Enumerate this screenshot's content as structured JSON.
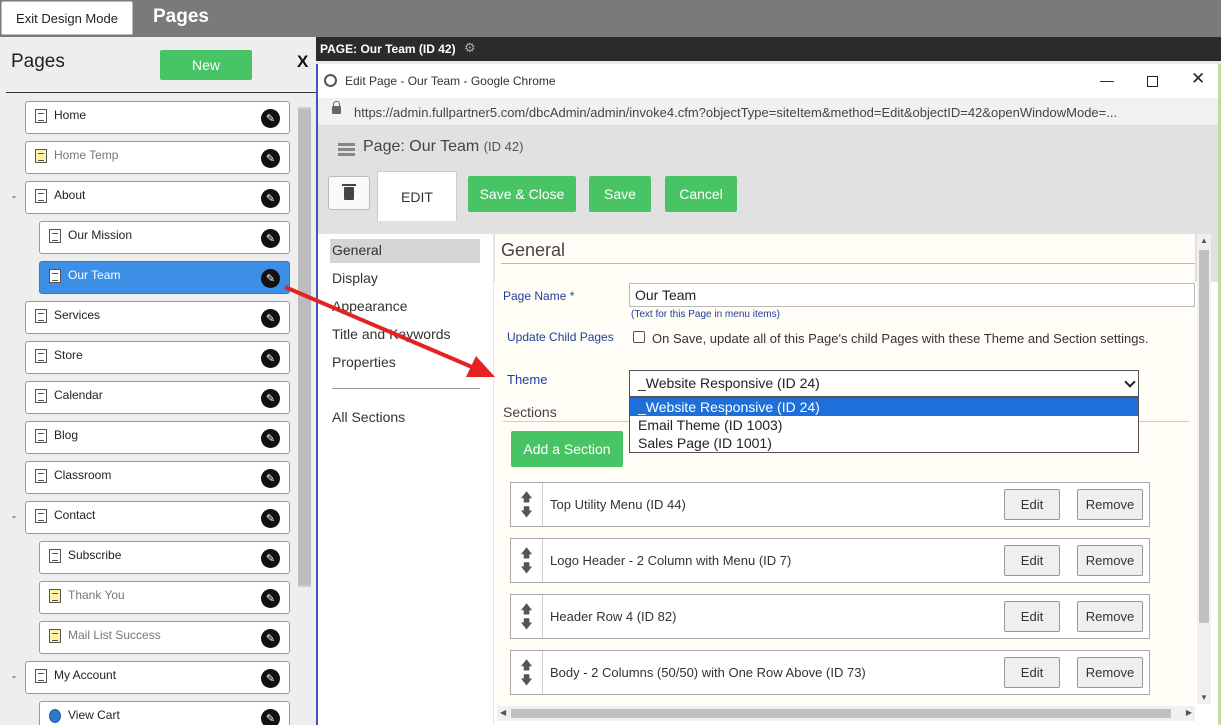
{
  "topbar": {
    "exit_label": "Exit Design Mode",
    "title": "Pages"
  },
  "left_panel": {
    "title": "Pages",
    "new_label": "New",
    "close_label": "X",
    "items": [
      {
        "label": "Home",
        "icon": "page-icon",
        "muted": false,
        "selected": false,
        "indent": false,
        "dash": false
      },
      {
        "label": "Home Temp",
        "icon": "page-hidden-icon",
        "muted": true,
        "selected": false,
        "indent": false,
        "dash": false
      },
      {
        "label": "About",
        "icon": "page-icon",
        "muted": false,
        "selected": false,
        "indent": false,
        "dash": true
      },
      {
        "label": "Our Mission",
        "icon": "page-icon",
        "muted": false,
        "selected": false,
        "indent": true,
        "dash": false
      },
      {
        "label": "Our Team",
        "icon": "page-icon",
        "muted": false,
        "selected": true,
        "indent": true,
        "dash": false
      },
      {
        "label": "Services",
        "icon": "page-icon",
        "muted": false,
        "selected": false,
        "indent": false,
        "dash": false
      },
      {
        "label": "Store",
        "icon": "page-icon",
        "muted": false,
        "selected": false,
        "indent": false,
        "dash": false
      },
      {
        "label": "Calendar",
        "icon": "page-icon",
        "muted": false,
        "selected": false,
        "indent": false,
        "dash": false
      },
      {
        "label": "Blog",
        "icon": "page-icon",
        "muted": false,
        "selected": false,
        "indent": false,
        "dash": false
      },
      {
        "label": "Classroom",
        "icon": "page-icon",
        "muted": false,
        "selected": false,
        "indent": false,
        "dash": false
      },
      {
        "label": "Contact",
        "icon": "page-icon",
        "muted": false,
        "selected": false,
        "indent": false,
        "dash": true
      },
      {
        "label": "Subscribe",
        "icon": "page-icon",
        "muted": false,
        "selected": false,
        "indent": true,
        "dash": false
      },
      {
        "label": "Thank You",
        "icon": "page-hidden-icon",
        "muted": true,
        "selected": false,
        "indent": true,
        "dash": false
      },
      {
        "label": "Mail List Success",
        "icon": "page-hidden-icon",
        "muted": true,
        "selected": false,
        "indent": true,
        "dash": false
      },
      {
        "label": "My Account",
        "icon": "page-icon",
        "muted": false,
        "selected": false,
        "indent": false,
        "dash": true
      },
      {
        "label": "View Cart",
        "icon": "globe-icon",
        "muted": false,
        "selected": false,
        "indent": true,
        "dash": false
      }
    ]
  },
  "strip": {
    "title": "PAGE: Our Team (ID 42)"
  },
  "chrome": {
    "window_title": "Edit Page - Our Team - Google Chrome",
    "url": "https://admin.fullpartner5.com/dbcAdmin/admin/invoke4.cfm?objectType=siteItem&method=Edit&objectID=42&openWindowMode=..."
  },
  "editor": {
    "page_title": "Page: Our Team",
    "page_id": "(ID 42)",
    "edit_tab": "EDIT",
    "buttons": {
      "save_close": "Save & Close",
      "save": "Save",
      "cancel": "Cancel"
    },
    "nav": [
      "General",
      "Display",
      "Appearance",
      "Title and Keywords",
      "Properties",
      "All Sections"
    ],
    "active_nav": "General",
    "section_title": "General",
    "page_name_label": "Page Name",
    "page_name_required": "*",
    "page_name_value": "Our Team",
    "page_name_hint": "(Text for this Page in menu items)",
    "update_child_label": "Update Child Pages",
    "update_child_text": "On Save, update all of this Page's child Pages with these Theme and Section settings.",
    "theme_label": "Theme",
    "theme_value": "_Website Responsive (ID 24)",
    "theme_options": [
      "_Website Responsive (ID 24)",
      "Email Theme (ID 1003)",
      "Sales Page (ID 1001)"
    ],
    "sections_label": "Sections",
    "add_section": "Add a Section",
    "sections": [
      {
        "name": "Top Utility Menu (ID 44)"
      },
      {
        "name": "Logo Header - 2 Column with Menu (ID 7)"
      },
      {
        "name": "Header Row 4 (ID 82)"
      },
      {
        "name": "Body - 2 Columns (50/50) with One Row Above (ID 73)"
      }
    ],
    "edit_label": "Edit",
    "remove_label": "Remove"
  },
  "colors": {
    "accent_green": "#49c464",
    "selected_blue": "#3d8fe6",
    "arrow_red": "#e52222",
    "label_blue": "#1f3f9a"
  }
}
